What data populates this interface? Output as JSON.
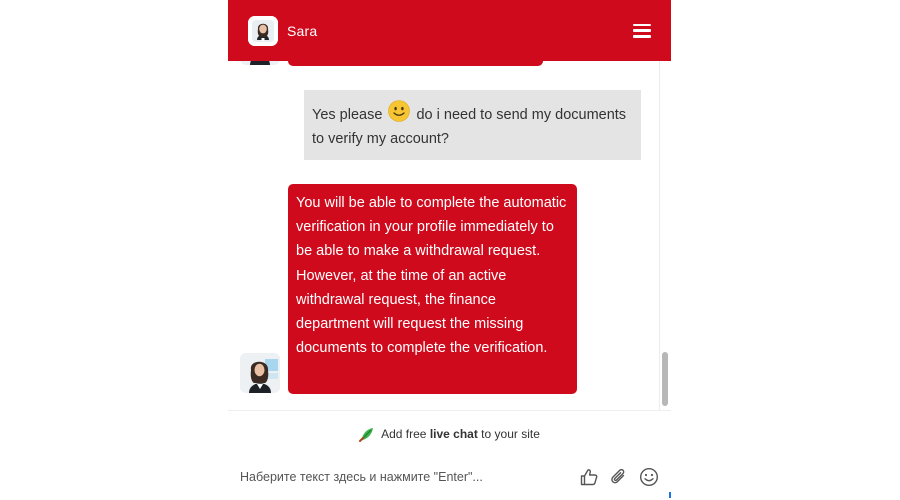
{
  "header": {
    "agent_name": "Sara",
    "accent_color": "#cf0a1d",
    "menu_icon": "hamburger-menu-icon",
    "avatar": "agent-avatar"
  },
  "messages": [
    {
      "sender": "visitor",
      "text_before_emoji": "Yes please ",
      "emoji": "smiley-emoji",
      "text_after_emoji": " do i need to send my documents to verify my account?"
    },
    {
      "sender": "agent",
      "text": "You will be able to complete the automatic verification in your profile immediately to be able to make a withdrawal request. However, at the time of an active withdrawal request, the finance department will request the missing documents to complete the verification."
    }
  ],
  "footer": {
    "promo_prefix": "Add free ",
    "promo_bold": "live chat",
    "promo_suffix": " to your site",
    "promo_icon": "leaf-brand-icon"
  },
  "input": {
    "placeholder": "Наберите текст здесь и нажмите \"Enter\"...",
    "value": "",
    "icons": [
      "thumbs-up-icon",
      "paperclip-icon",
      "smiley-icon"
    ]
  }
}
